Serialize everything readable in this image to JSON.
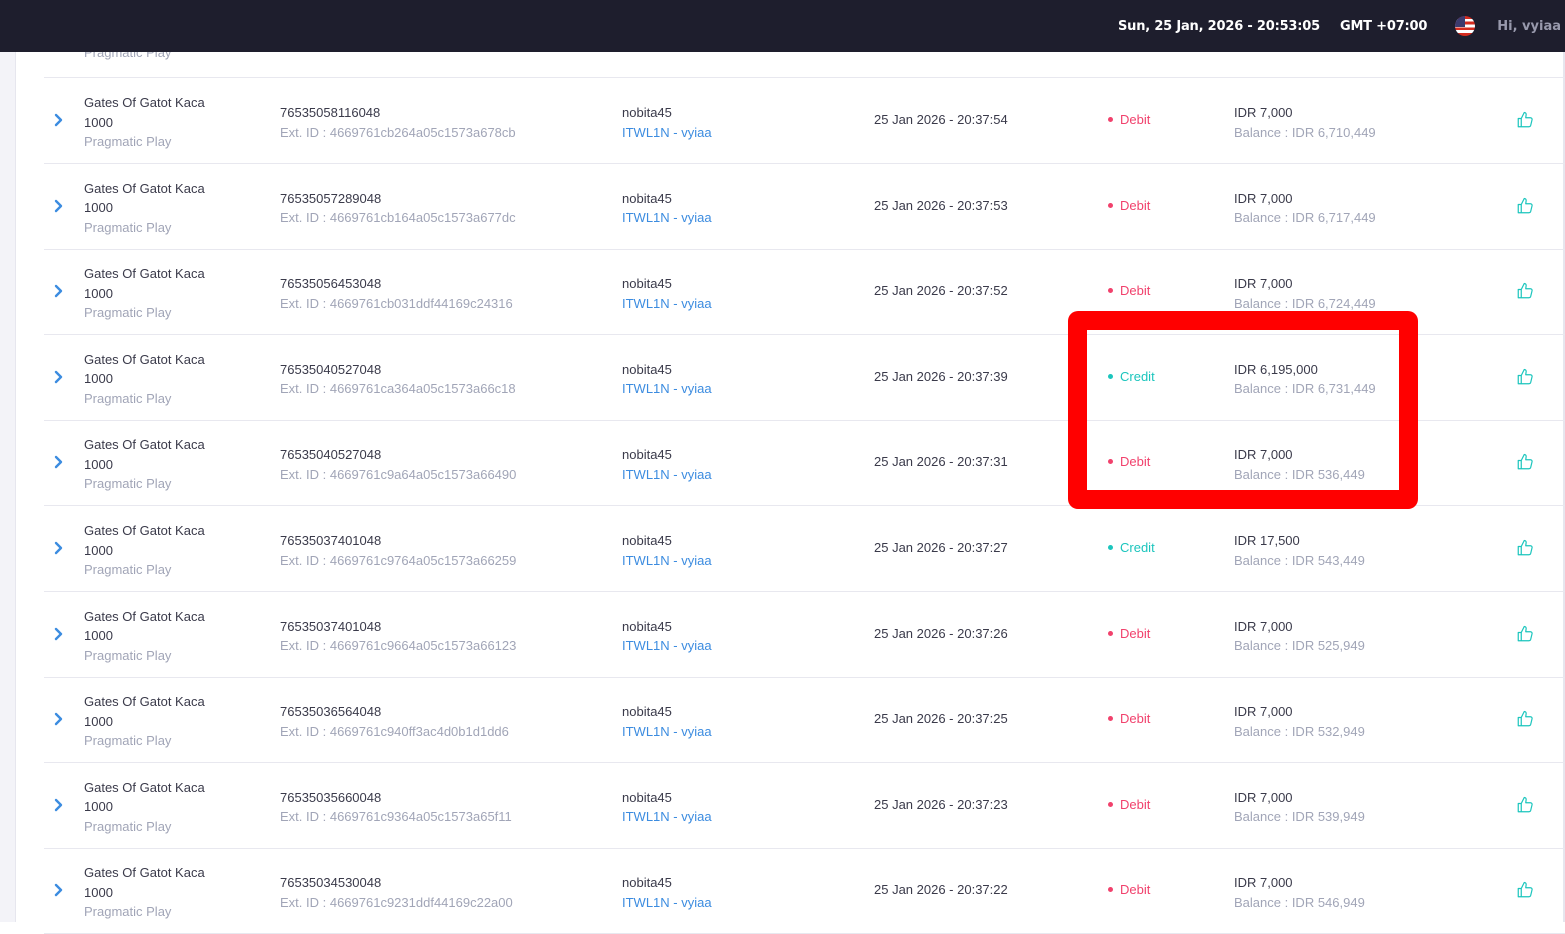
{
  "header": {
    "datetime": "Sun, 25 Jan, 2026 - 20:53:05",
    "timezone": "GMT +07:00",
    "greeting": "Hi, vyiaa",
    "flag_icon": "us-flag-icon",
    "bg_color": "#1e1e2d"
  },
  "previous_row": {
    "provider": "Pragmatic Play"
  },
  "colors": {
    "debit": "#f1416c",
    "credit": "#1bc5bd",
    "agent_link": "#3c8ce0",
    "highlight": "#ff0000",
    "like_icon": "#1bc5bd"
  },
  "icons": {
    "expand": "chevron-right-icon",
    "status": "thumbs-up-icon"
  },
  "rows": [
    {
      "game": "Gates Of Gatot Kaca",
      "game_variant": "1000",
      "provider": "Pragmatic Play",
      "tx_id": "76535058116048",
      "ext_id": "Ext. ID : 4669761cb264a05c1573a678cb",
      "player": "nobita45",
      "agent": "ITWL1N - vyiaa",
      "date": "25 Jan 2026 - 20:37:54",
      "type": "Debit",
      "amount": "IDR 7,000",
      "balance": "Balance : IDR 6,710,449"
    },
    {
      "game": "Gates Of Gatot Kaca",
      "game_variant": "1000",
      "provider": "Pragmatic Play",
      "tx_id": "76535057289048",
      "ext_id": "Ext. ID : 4669761cb164a05c1573a677dc",
      "player": "nobita45",
      "agent": "ITWL1N - vyiaa",
      "date": "25 Jan 2026 - 20:37:53",
      "type": "Debit",
      "amount": "IDR 7,000",
      "balance": "Balance : IDR 6,717,449"
    },
    {
      "game": "Gates Of Gatot Kaca",
      "game_variant": "1000",
      "provider": "Pragmatic Play",
      "tx_id": "76535056453048",
      "ext_id": "Ext. ID : 4669761cb031ddf44169c24316",
      "player": "nobita45",
      "agent": "ITWL1N - vyiaa",
      "date": "25 Jan 2026 - 20:37:52",
      "type": "Debit",
      "amount": "IDR 7,000",
      "balance": "Balance : IDR 6,724,449"
    },
    {
      "game": "Gates Of Gatot Kaca",
      "game_variant": "1000",
      "provider": "Pragmatic Play",
      "tx_id": "76535040527048",
      "ext_id": "Ext. ID : 4669761ca364a05c1573a66c18",
      "player": "nobita45",
      "agent": "ITWL1N - vyiaa",
      "date": "25 Jan 2026 - 20:37:39",
      "type": "Credit",
      "amount": "IDR 6,195,000",
      "balance": "Balance : IDR 6,731,449"
    },
    {
      "game": "Gates Of Gatot Kaca",
      "game_variant": "1000",
      "provider": "Pragmatic Play",
      "tx_id": "76535040527048",
      "ext_id": "Ext. ID : 4669761c9a64a05c1573a66490",
      "player": "nobita45",
      "agent": "ITWL1N - vyiaa",
      "date": "25 Jan 2026 - 20:37:31",
      "type": "Debit",
      "amount": "IDR 7,000",
      "balance": "Balance : IDR 536,449"
    },
    {
      "game": "Gates Of Gatot Kaca",
      "game_variant": "1000",
      "provider": "Pragmatic Play",
      "tx_id": "76535037401048",
      "ext_id": "Ext. ID : 4669761c9764a05c1573a66259",
      "player": "nobita45",
      "agent": "ITWL1N - vyiaa",
      "date": "25 Jan 2026 - 20:37:27",
      "type": "Credit",
      "amount": "IDR 17,500",
      "balance": "Balance : IDR 543,449"
    },
    {
      "game": "Gates Of Gatot Kaca",
      "game_variant": "1000",
      "provider": "Pragmatic Play",
      "tx_id": "76535037401048",
      "ext_id": "Ext. ID : 4669761c9664a05c1573a66123",
      "player": "nobita45",
      "agent": "ITWL1N - vyiaa",
      "date": "25 Jan 2026 - 20:37:26",
      "type": "Debit",
      "amount": "IDR 7,000",
      "balance": "Balance : IDR 525,949"
    },
    {
      "game": "Gates Of Gatot Kaca",
      "game_variant": "1000",
      "provider": "Pragmatic Play",
      "tx_id": "76535036564048",
      "ext_id": "Ext. ID : 4669761c940ff3ac4d0b1d1dd6",
      "player": "nobita45",
      "agent": "ITWL1N - vyiaa",
      "date": "25 Jan 2026 - 20:37:25",
      "type": "Debit",
      "amount": "IDR 7,000",
      "balance": "Balance : IDR 532,949"
    },
    {
      "game": "Gates Of Gatot Kaca",
      "game_variant": "1000",
      "provider": "Pragmatic Play",
      "tx_id": "76535035660048",
      "ext_id": "Ext. ID : 4669761c9364a05c1573a65f11",
      "player": "nobita45",
      "agent": "ITWL1N - vyiaa",
      "date": "25 Jan 2026 - 20:37:23",
      "type": "Debit",
      "amount": "IDR 7,000",
      "balance": "Balance : IDR 539,949"
    },
    {
      "game": "Gates Of Gatot Kaca",
      "game_variant": "1000",
      "provider": "Pragmatic Play",
      "tx_id": "76535034530048",
      "ext_id": "Ext. ID : 4669761c9231ddf44169c22a00",
      "player": "nobita45",
      "agent": "ITWL1N - vyiaa",
      "date": "25 Jan 2026 - 20:37:22",
      "type": "Debit",
      "amount": "IDR 7,000",
      "balance": "Balance : IDR 546,949"
    }
  ]
}
